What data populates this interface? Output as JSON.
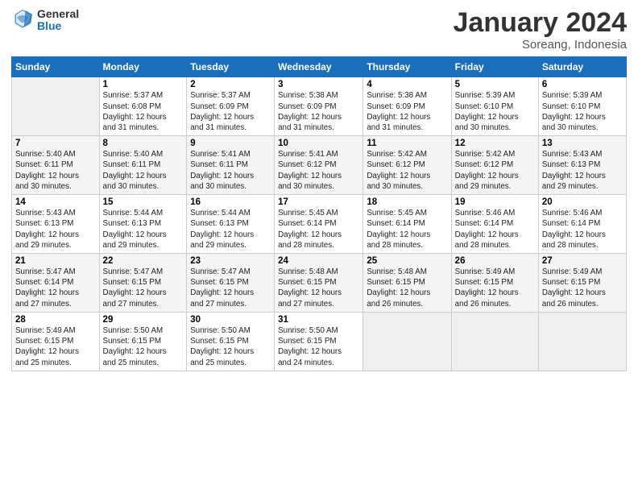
{
  "logo": {
    "general": "General",
    "blue": "Blue"
  },
  "title": "January 2024",
  "subtitle": "Soreang, Indonesia",
  "days_of_week": [
    "Sunday",
    "Monday",
    "Tuesday",
    "Wednesday",
    "Thursday",
    "Friday",
    "Saturday"
  ],
  "weeks": [
    [
      {
        "day": "",
        "info": ""
      },
      {
        "day": "1",
        "info": "Sunrise: 5:37 AM\nSunset: 6:08 PM\nDaylight: 12 hours and 31 minutes."
      },
      {
        "day": "2",
        "info": "Sunrise: 5:37 AM\nSunset: 6:09 PM\nDaylight: 12 hours and 31 minutes."
      },
      {
        "day": "3",
        "info": "Sunrise: 5:38 AM\nSunset: 6:09 PM\nDaylight: 12 hours and 31 minutes."
      },
      {
        "day": "4",
        "info": "Sunrise: 5:38 AM\nSunset: 6:09 PM\nDaylight: 12 hours and 31 minutes."
      },
      {
        "day": "5",
        "info": "Sunrise: 5:39 AM\nSunset: 6:10 PM\nDaylight: 12 hours and 30 minutes."
      },
      {
        "day": "6",
        "info": "Sunrise: 5:39 AM\nSunset: 6:10 PM\nDaylight: 12 hours and 30 minutes."
      }
    ],
    [
      {
        "day": "7",
        "info": ""
      },
      {
        "day": "8",
        "info": "Sunrise: 5:40 AM\nSunset: 6:11 PM\nDaylight: 12 hours and 30 minutes."
      },
      {
        "day": "9",
        "info": "Sunrise: 5:41 AM\nSunset: 6:11 PM\nDaylight: 12 hours and 30 minutes."
      },
      {
        "day": "10",
        "info": "Sunrise: 5:41 AM\nSunset: 6:12 PM\nDaylight: 12 hours and 30 minutes."
      },
      {
        "day": "11",
        "info": "Sunrise: 5:42 AM\nSunset: 6:12 PM\nDaylight: 12 hours and 30 minutes."
      },
      {
        "day": "12",
        "info": "Sunrise: 5:42 AM\nSunset: 6:12 PM\nDaylight: 12 hours and 29 minutes."
      },
      {
        "day": "13",
        "info": "Sunrise: 5:43 AM\nSunset: 6:13 PM\nDaylight: 12 hours and 29 minutes."
      }
    ],
    [
      {
        "day": "14",
        "info": ""
      },
      {
        "day": "15",
        "info": "Sunrise: 5:44 AM\nSunset: 6:13 PM\nDaylight: 12 hours and 29 minutes."
      },
      {
        "day": "16",
        "info": "Sunrise: 5:44 AM\nSunset: 6:13 PM\nDaylight: 12 hours and 29 minutes."
      },
      {
        "day": "17",
        "info": "Sunrise: 5:45 AM\nSunset: 6:14 PM\nDaylight: 12 hours and 28 minutes."
      },
      {
        "day": "18",
        "info": "Sunrise: 5:45 AM\nSunset: 6:14 PM\nDaylight: 12 hours and 28 minutes."
      },
      {
        "day": "19",
        "info": "Sunrise: 5:46 AM\nSunset: 6:14 PM\nDaylight: 12 hours and 28 minutes."
      },
      {
        "day": "20",
        "info": "Sunrise: 5:46 AM\nSunset: 6:14 PM\nDaylight: 12 hours and 28 minutes."
      }
    ],
    [
      {
        "day": "21",
        "info": ""
      },
      {
        "day": "22",
        "info": "Sunrise: 5:47 AM\nSunset: 6:15 PM\nDaylight: 12 hours and 27 minutes."
      },
      {
        "day": "23",
        "info": "Sunrise: 5:47 AM\nSunset: 6:15 PM\nDaylight: 12 hours and 27 minutes."
      },
      {
        "day": "24",
        "info": "Sunrise: 5:48 AM\nSunset: 6:15 PM\nDaylight: 12 hours and 27 minutes."
      },
      {
        "day": "25",
        "info": "Sunrise: 5:48 AM\nSunset: 6:15 PM\nDaylight: 12 hours and 26 minutes."
      },
      {
        "day": "26",
        "info": "Sunrise: 5:49 AM\nSunset: 6:15 PM\nDaylight: 12 hours and 26 minutes."
      },
      {
        "day": "27",
        "info": "Sunrise: 5:49 AM\nSunset: 6:15 PM\nDaylight: 12 hours and 26 minutes."
      }
    ],
    [
      {
        "day": "28",
        "info": ""
      },
      {
        "day": "29",
        "info": "Sunrise: 5:50 AM\nSunset: 6:15 PM\nDaylight: 12 hours and 25 minutes."
      },
      {
        "day": "30",
        "info": "Sunrise: 5:50 AM\nSunset: 6:15 PM\nDaylight: 12 hours and 25 minutes."
      },
      {
        "day": "31",
        "info": "Sunrise: 5:50 AM\nSunset: 6:15 PM\nDaylight: 12 hours and 24 minutes."
      },
      {
        "day": "",
        "info": ""
      },
      {
        "day": "",
        "info": ""
      },
      {
        "day": "",
        "info": ""
      }
    ]
  ],
  "week1_sunday_info": "Sunrise: 5:40 AM\nSunset: 6:11 PM\nDaylight: 12 hours and 30 minutes.",
  "week3_sunday_info": "Sunrise: 5:43 AM\nSunset: 6:13 PM\nDaylight: 12 hours and 29 minutes.",
  "week4_sunday_info": "Sunrise: 5:47 AM\nSunset: 6:14 PM\nDaylight: 12 hours and 27 minutes.",
  "week5_sunday_info": "Sunrise: 5:49 AM\nSunset: 6:15 PM\nDaylight: 12 hours and 25 minutes."
}
